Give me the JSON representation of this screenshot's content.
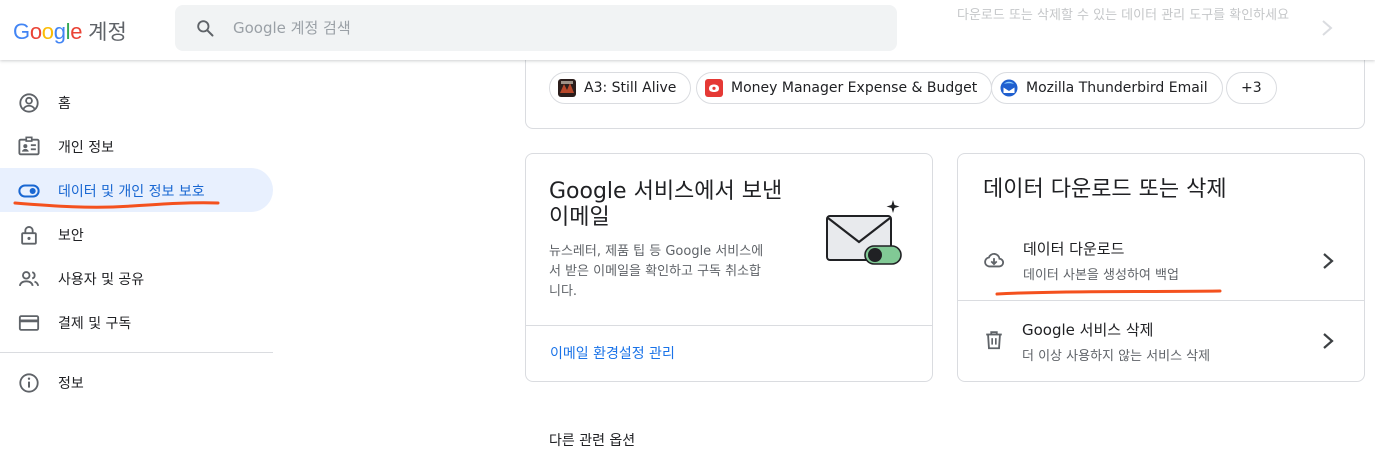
{
  "header": {
    "logo_google": "Google",
    "logo_product": "계정",
    "search_placeholder": "Google 계정 검색",
    "notice_text": "다운로드 또는 삭제할 수 있는 데이터 관리 도구를 확인하세요",
    "colors": {
      "g_blue": "#4285F4",
      "g_red": "#EA4335",
      "g_yellow": "#FBBC05",
      "g_green": "#34A853"
    }
  },
  "sidebar": {
    "items": [
      {
        "label": "홈",
        "icon": "account-circle-icon"
      },
      {
        "label": "개인 정보",
        "icon": "id-card-icon"
      },
      {
        "label": "데이터 및 개인 정보 보호",
        "icon": "toggle-icon",
        "active": true
      },
      {
        "label": "보안",
        "icon": "lock-icon"
      },
      {
        "label": "사용자 및 공유",
        "icon": "people-icon"
      },
      {
        "label": "결제 및 구독",
        "icon": "credit-card-icon"
      },
      {
        "label": "정보",
        "icon": "info-icon"
      }
    ]
  },
  "apps": {
    "chips": [
      {
        "label": "A3: Still Alive",
        "icon": "a3-game-icon"
      },
      {
        "label": "Money Manager Expense & Budget",
        "icon": "money-manager-icon"
      },
      {
        "label": "Mozilla Thunderbird Email",
        "icon": "thunderbird-icon"
      }
    ],
    "more_label": "+3"
  },
  "email_card": {
    "title_line1": "Google 서비스에서 보낸",
    "title_line2": "이메일",
    "desc_line1": "뉴스레터, 제품 팁 등 Google 서비스에",
    "desc_line2": "서 받은 이메일을 확인하고 구독 취소합",
    "desc_line3": "니다.",
    "link": "이메일 환경설정 관리",
    "illustration_icon": "envelope-toggle-illustration-icon"
  },
  "data_card": {
    "title": "데이터 다운로드 또는 삭제",
    "rows": [
      {
        "title": "데이터 다운로드",
        "subtitle": "데이터 사본을 생성하여 백업",
        "icon": "cloud-download-icon"
      },
      {
        "title": "Google 서비스 삭제",
        "subtitle": "더 이상 사용하지 않는 서비스 삭제",
        "icon": "trash-icon"
      }
    ]
  },
  "other_options_label": "다른 관련 옵션",
  "annotation_color": "#f4511e"
}
